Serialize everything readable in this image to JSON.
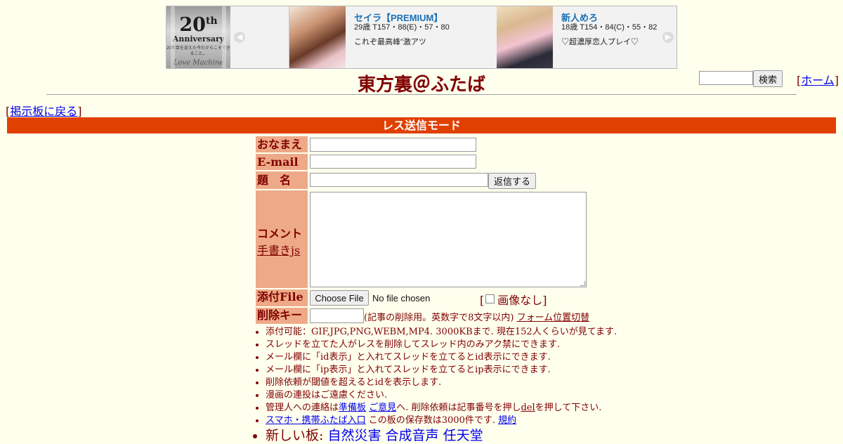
{
  "banner": {
    "anniversary": {
      "big": "20",
      "sup": "th",
      "mid": "Anniversary",
      "tiny": "20年目を迎えた今だからこそできること。",
      "script": "Love Machine"
    },
    "cards": [
      {
        "name": "セイラ【PREMIUM】",
        "stats": "29歳 T157・88(E)・57・80",
        "catch": "これぞ最高峰\"激アツ"
      },
      {
        "name": "新人めろ",
        "stats": "18歳 T154・84(C)・55・82",
        "catch": "♡超濃厚恋人プレイ♡"
      }
    ],
    "prev_icon": "chevron-left-icon",
    "next_icon": "chevron-right-icon"
  },
  "search": {
    "button": "検索"
  },
  "home": {
    "open": "[",
    "label": "ホーム",
    "close": "]"
  },
  "site_title": "東方裏＠ふたば",
  "back": {
    "open": "[",
    "label": "掲示板に戻る",
    "close": "]"
  },
  "mode": "レス送信モード",
  "form": {
    "name_label": "おなまえ",
    "email_label": "E-mail",
    "subject_label": "題　名",
    "submit": "返信する",
    "comment_label": "コメント",
    "handwrite_link": "手書きjs",
    "file_label": "添付File",
    "file_button": "Choose File",
    "file_status": "No file chosen",
    "noimg_open": "[",
    "noimg_label": "画像なし",
    "noimg_close": "]",
    "delkey_label": "削除キー",
    "delkey_note": "(記事の削除用。英数字で8文字以内)",
    "form_toggle": "フォーム位置切替"
  },
  "notes": {
    "n1": "添付可能：GIF,JPG,PNG,WEBM,MP4. 3000KBまで. 現在152人くらいが見てます.",
    "n2": "スレッドを立てた人がレスを削除してスレッド内のみアク禁にできます.",
    "n3": "メール欄に「id表示」と入れてスレッドを立てるとid表示にできます.",
    "n4": "メール欄に「ip表示」と入れてスレッドを立てるとip表示にできます.",
    "n5": "削除依頼が閾値を超えるとidを表示します.",
    "n6": "漫画の連投はご遠慮ください.",
    "n7_a": "管理人への連絡は",
    "n7_link1": "準備板",
    "n7_sp": " ",
    "n7_link2": "ご意見",
    "n7_b": "へ. 削除依頼は記事番号を押し",
    "n7_link3": "del",
    "n7_c": "を押して下さい.",
    "n8_link1": "スマホ・携帯ふたば入口",
    "n8_text": " この板の保存数は3000件です. ",
    "n8_link2": "規約",
    "n9_text": "新しい板: ",
    "n9_links": [
      "自然災害",
      "合成音声",
      "任天堂"
    ]
  }
}
